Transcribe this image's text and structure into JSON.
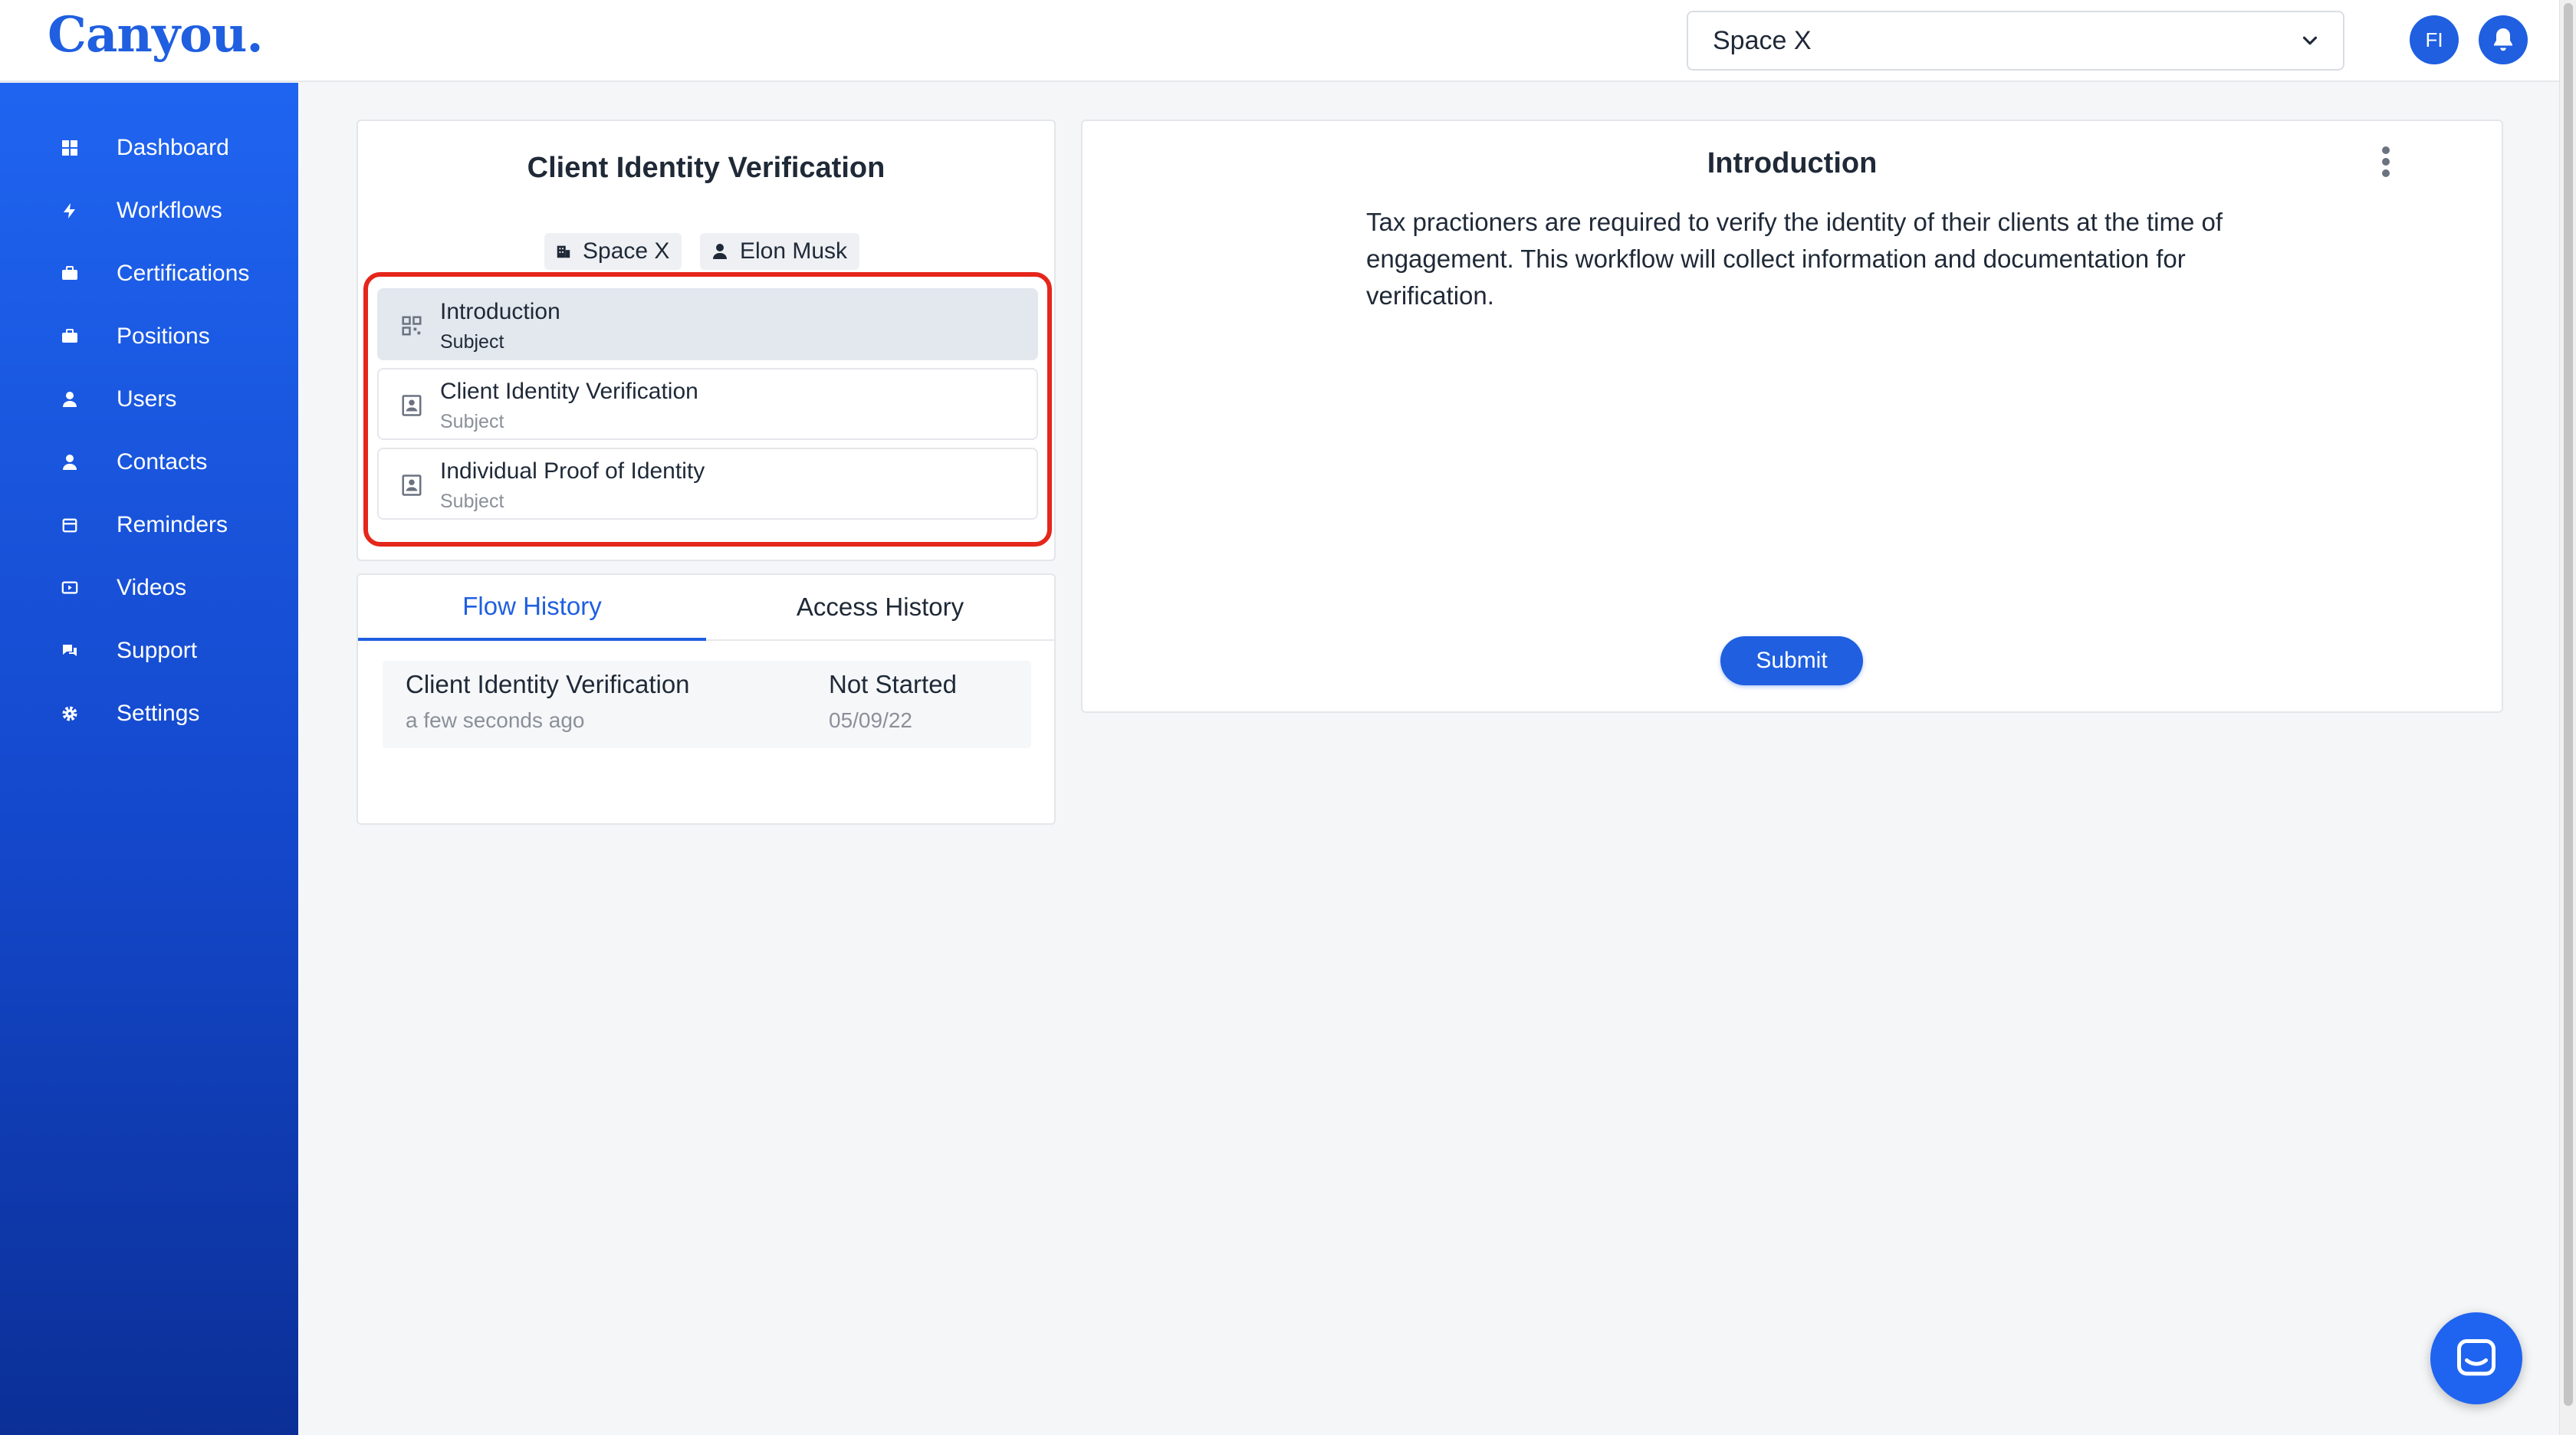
{
  "app": {
    "logo": "Canyou."
  },
  "header": {
    "org_select_value": "Space X",
    "avatar_initials": "FI"
  },
  "sidebar": {
    "items": [
      {
        "label": "Dashboard",
        "icon": "grid-icon"
      },
      {
        "label": "Workflows",
        "icon": "bolt-icon"
      },
      {
        "label": "Certifications",
        "icon": "briefcase-icon"
      },
      {
        "label": "Positions",
        "icon": "briefcase-icon"
      },
      {
        "label": "Users",
        "icon": "user-icon"
      },
      {
        "label": "Contacts",
        "icon": "user-icon"
      },
      {
        "label": "Reminders",
        "icon": "calendar-icon"
      },
      {
        "label": "Videos",
        "icon": "video-icon"
      },
      {
        "label": "Support",
        "icon": "chat-icon"
      },
      {
        "label": "Settings",
        "icon": "gear-icon"
      }
    ]
  },
  "workflow": {
    "title": "Client Identity Verification",
    "org_chip": "Space X",
    "person_chip": "Elon Musk",
    "steps": [
      {
        "title": "Introduction",
        "subtitle": "Subject",
        "active": true,
        "icon": "qr-grid-icon"
      },
      {
        "title": "Client Identity Verification",
        "subtitle": "Subject",
        "active": false,
        "icon": "id-card-icon"
      },
      {
        "title": "Individual Proof of Identity",
        "subtitle": "Subject",
        "active": false,
        "icon": "id-card-icon"
      }
    ]
  },
  "history": {
    "tabs": [
      "Flow History",
      "Access History"
    ],
    "active_tab": "Flow History",
    "rows": [
      {
        "name": "Client Identity Verification",
        "time": "a few seconds ago",
        "status": "Not Started",
        "date": "05/09/22"
      }
    ]
  },
  "content": {
    "title": "Introduction",
    "body": "Tax practioners are required to verify the identity of their clients at the time of engagement. This workflow will collect information and documentation for verification.",
    "submit_label": "Submit"
  },
  "colors": {
    "brand": "#1f5fe0",
    "highlight": "#e5261b"
  }
}
